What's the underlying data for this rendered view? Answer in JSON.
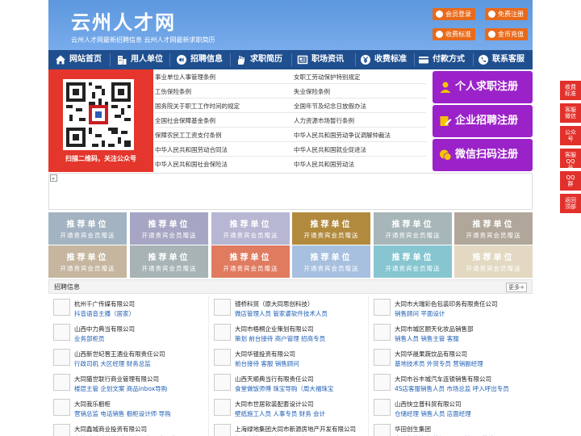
{
  "header": {
    "title": "云州人才网",
    "subtitle": "云州人才网最新招聘信息    云州人才网最新求职简历",
    "buttons": [
      "会员登录",
      "免费注册",
      "收费标准",
      "金币充值"
    ]
  },
  "nav": {
    "items": [
      "网站首页",
      "用人单位",
      "招聘信息",
      "求职简历",
      "职场资讯",
      "收费标准",
      "付款方式",
      "联系客服"
    ]
  },
  "qr": {
    "caption": "扫描二维码，关注公众号"
  },
  "links": {
    "left": [
      "事业单位人事管理条例",
      "工伤保险条例",
      "国务院关于职工工作时间的规定",
      "全国社会保障基金条例",
      "保障农民工工资支付条例",
      "中华人民共和国劳动合同法",
      "中华人民共和国社会保险法"
    ],
    "right": [
      "女职工劳动保护特别规定",
      "失业保险条例",
      "全国年节及纪念日放假办法",
      "人力资源市场暂行条例",
      "中华人民共和国劳动争议调解仲裁法",
      "中华人民共和国就业促进法",
      "中华人民共和国劳动法"
    ]
  },
  "register": [
    "个人求职注册",
    "企业招聘注册",
    "微信扫码注册"
  ],
  "tiles": {
    "line1": "推荐单位",
    "line2": "开通贵宾会员赠送",
    "colors": [
      "#a3b3c2",
      "#a6a6c4",
      "#b7b6d3",
      "#b18a3e",
      "#a7b6b8",
      "#b0a79a",
      "#c6b69f",
      "#a7b3b5",
      "#e07b60",
      "#a8c0df",
      "#87c6d1",
      "#e3d9c2"
    ]
  },
  "jobs": {
    "title": "招聘信息",
    "more": "更多+",
    "companies": [
      {
        "name": "杭州千广传媒有限公司",
        "positions": "抖音语音主播（居家）"
      },
      {
        "name": "镜桥科贸（原大同思创科技）",
        "positions": "微店管理人员 管家婆软件技术人员"
      },
      {
        "name": "大同市大瑞彩色包装印务有限责任公司",
        "positions": "销售顾问 平面设计"
      },
      {
        "name": "山西中力典当有限公司",
        "positions": "业务部柜员"
      },
      {
        "name": "大同市梧桐企业策划有限公司",
        "positions": "策划 前台接待 商户管理 招商专员"
      },
      {
        "name": "大同市城区颐天化妆品销售部",
        "positions": "销售人员 销售主管 客服"
      },
      {
        "name": "山西新世纪晋王酒业有限责任公司",
        "positions": "行政司机 大区经理 财务总监"
      },
      {
        "name": "大同华锟投资有限公司",
        "positions": "前台接待 客服 销售顾问"
      },
      {
        "name": "大同华晟果蔬饮品有限公司",
        "positions": "基地技术员 外贸专员 营销副经理"
      },
      {
        "name": "大同猫世联行商业管理有限公司",
        "positions": "楼层主管 企划文案 商品inbox导购"
      },
      {
        "name": "山西天顺典当行有限责任公司",
        "positions": "食堂做饭师傅 珠宝导购（周大福珠宝"
      },
      {
        "name": "大同市谷丰城汽车连锁销售有限公司",
        "positions": "4S店客服销售人员 市场总监 呼入呼出专员"
      },
      {
        "name": "大同我乐橱柜",
        "positions": "营销总监 电话销售 橱柜设计师 导购"
      },
      {
        "name": "大同市世居软装配套设计公司",
        "positions": "壁纸施工人员 人事专员 财务 会计"
      },
      {
        "name": "山西快立普科贸有限公司",
        "positions": "仓储经理 销售人员 店面经理"
      },
      {
        "name": "大同鑫城商业投资有限公司",
        "positions": "主管 专卖店店长 专卖店导购员 客服专员"
      },
      {
        "name": "上海绿地集团大同市新源房地产开发有限公司",
        "positions": "招商主管 研展专员 客服 客服经理"
      },
      {
        "name": "华田创生集团",
        "positions": "自动化维修 经营经理 QC验证员 统计员"
      }
    ]
  },
  "side": [
    "收费标准",
    "客服微信",
    "公众号",
    "客服QQ号",
    "QQ群",
    "返回顶部"
  ]
}
